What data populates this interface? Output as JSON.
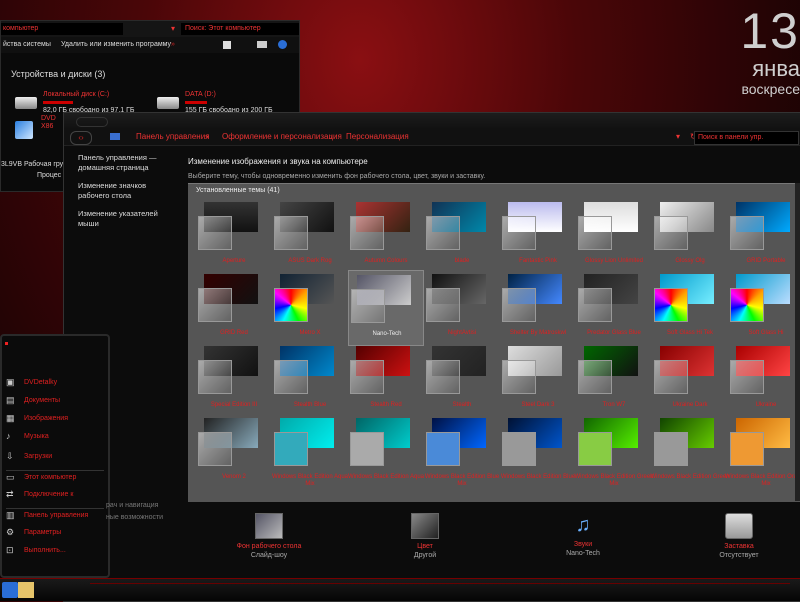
{
  "desktop": {
    "clock_day": "13",
    "clock_month": "янва",
    "clock_weekday": "воскресе"
  },
  "explorer": {
    "address": "компьютер",
    "search_placeholder": "Поиск: Этот компьютер",
    "toolbar_props": "йства системы",
    "toolbar_uninstall": "Удалить или изменить программу",
    "group_title": "Устройства и диски (3)",
    "drives": [
      {
        "name": "Локальный диск (C:)",
        "free": "82,0 ГБ свободно из 97,1 ГБ"
      },
      {
        "name": "DATA (D:)",
        "free": "155 ГБ свободно из 200 ГБ"
      },
      {
        "name": "DVD",
        "free": "X86"
      }
    ],
    "footer_group": "3L9VB Рабочая груп",
    "footer_proc": "Процес"
  },
  "control_panel": {
    "breadcrumbs": [
      "Панель управления",
      "Оформление и персонализация",
      "Персонализация"
    ],
    "search_placeholder": "Поиск в панели упр.",
    "sidebar": [
      "Панель управления — домашняя страница",
      "Изменение значков рабочего стола",
      "Изменение указателей мыши"
    ],
    "title": "Изменение изображения и звука на компьютере",
    "subtitle": "Выберите тему, чтобы одновременно изменить фон рабочего стола, цвет, звуки и заставку.",
    "themes_header": "Установленные темы (41)",
    "themes": [
      "Aperture",
      "ASUS Dark Rog",
      "Autumn Colours",
      "blade",
      "Fantastic Pink",
      "Glossy Lion Unlimited",
      "Glossy Olg",
      "GRID Portable",
      "GRID Red",
      "Metro X",
      "Nano-Tech",
      "NightAvtisi",
      "Shelter By Matroskwl",
      "Predator Glass Blue",
      "Soft Glass Hi Tek",
      "Soft Glass Hi",
      "Special Edition III",
      "Stealth Blue",
      "Stealth Red",
      "Stealth",
      "Steel Dark 3",
      "Tron W7",
      "Ukraine Dark",
      "Ukraine",
      "Venom 2",
      "Windows Black Edition Aqua Mix",
      "Windows Black Edition Aqua",
      "Windows Black Edition Blue Mix",
      "Windows Black Edition Blue",
      "Windows Black Edition Green Mix",
      "Windows Black Edition Green",
      "Windows Black Edition Orange Mix"
    ],
    "bottom": [
      {
        "title": "Фон рабочего стола",
        "sub": "Слайд-шоу"
      },
      {
        "title": "Цвет",
        "sub": "Другой"
      },
      {
        "title": "Звуки",
        "sub": "Nano-Tech"
      },
      {
        "title": "Заставка",
        "sub": "Отсутствует"
      }
    ]
  },
  "start_menu": {
    "items": [
      "DVDetalky",
      "Документы",
      "Изображения",
      "Музыка",
      "Загрузки",
      "Этот компьютер",
      "Подключение к",
      "Панель управления",
      "Параметры",
      "Выполнить..."
    ],
    "side_items": [
      "рач и навигация",
      "ные возможности"
    ]
  }
}
